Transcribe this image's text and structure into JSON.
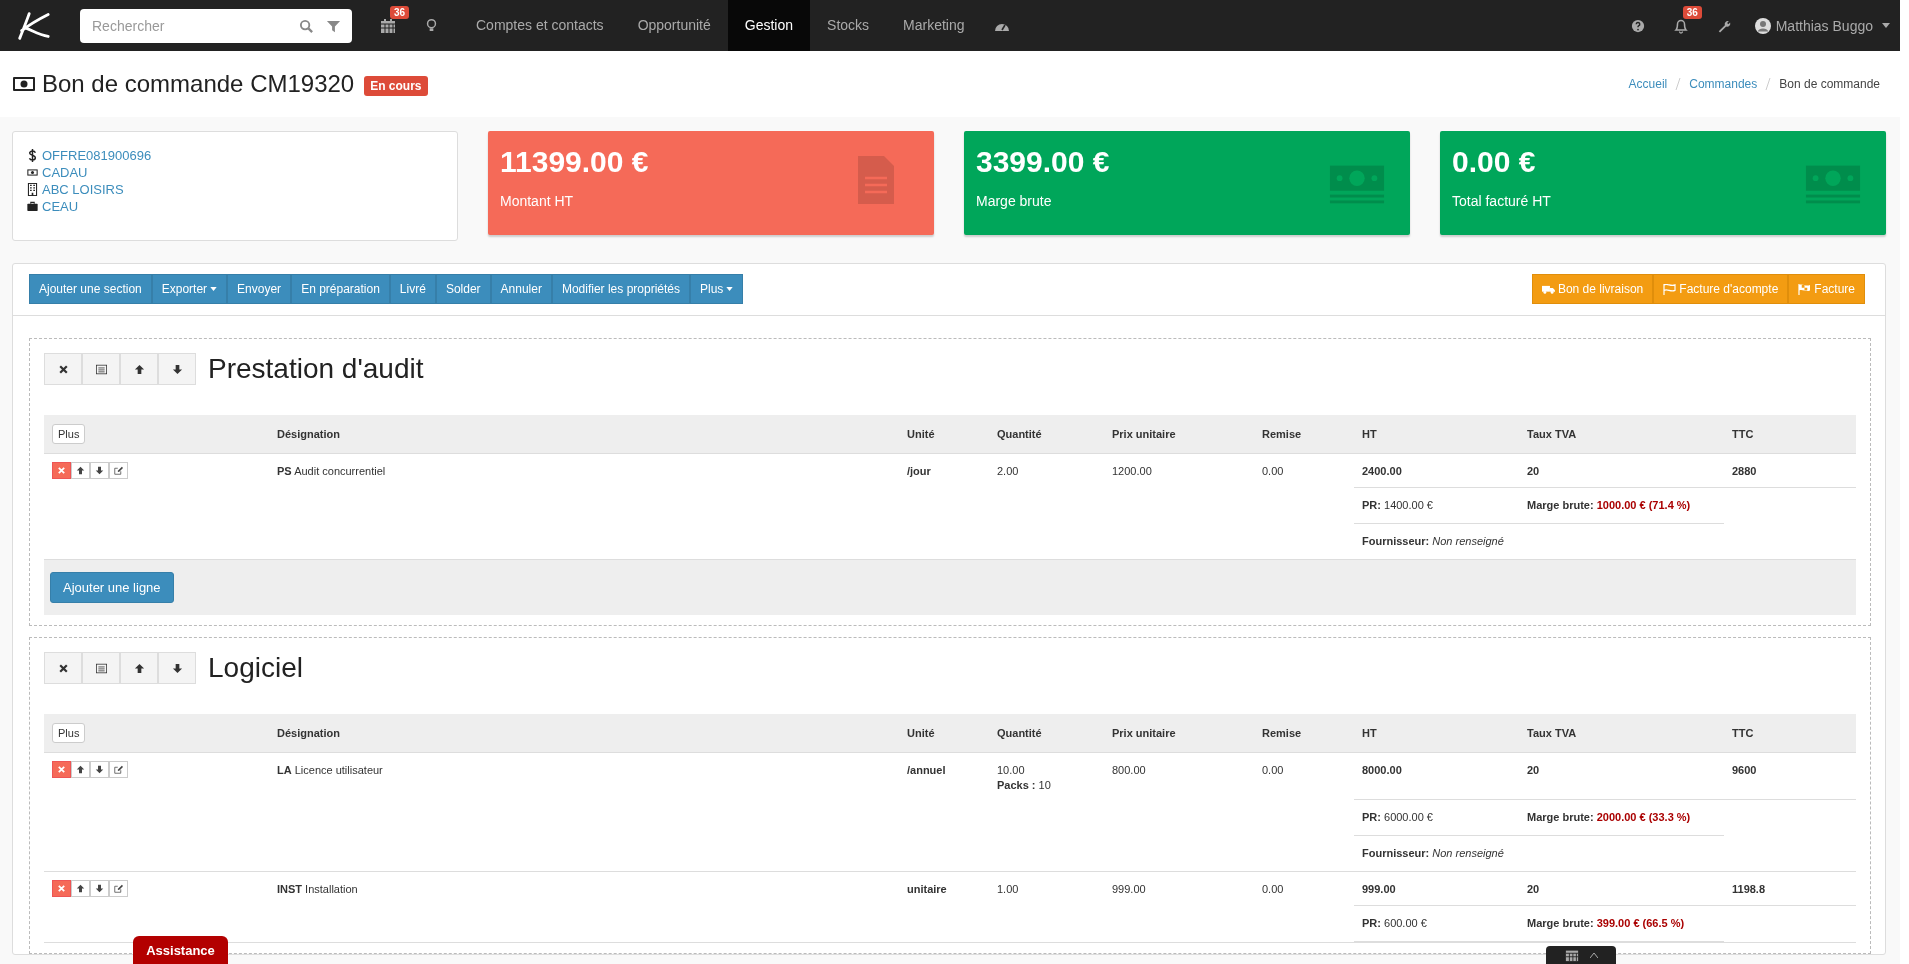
{
  "navbar": {
    "search": {
      "placeholder": "Rechercher"
    },
    "calendar_badge": "36",
    "menu": [
      {
        "label": "Comptes et contacts",
        "selected": false
      },
      {
        "label": "Opportunité",
        "selected": false
      },
      {
        "label": "Gestion",
        "selected": true
      },
      {
        "label": "Stocks",
        "selected": false
      },
      {
        "label": "Marketing",
        "selected": false
      }
    ],
    "notifications_badge": "36",
    "user": {
      "name": "Matthias Buggo"
    }
  },
  "page": {
    "title": "Bon de commande CM19320",
    "status": "En cours",
    "breadcrumb": [
      {
        "label": "Accueil",
        "link": true
      },
      {
        "label": "Commandes",
        "link": true
      },
      {
        "label": "Bon de commande",
        "link": false
      }
    ]
  },
  "links": [
    "OFFRE081900696",
    "CADAU",
    "ABC LOISIRS",
    "CEAU"
  ],
  "stats": [
    {
      "value": "11399.00 €",
      "label": "Montant HT",
      "color": "#f56a58"
    },
    {
      "value": "3399.00 €",
      "label": "Marge brute",
      "color": "#00a65a"
    },
    {
      "value": "0.00 €",
      "label": "Total facturé HT",
      "color": "#00a65a"
    }
  ],
  "toolbar": {
    "actions": [
      {
        "label": "Ajouter une section",
        "dropdown": false
      },
      {
        "label": "Exporter",
        "dropdown": true
      },
      {
        "label": "Envoyer",
        "dropdown": false
      },
      {
        "label": "En préparation",
        "dropdown": false
      },
      {
        "label": "Livré",
        "dropdown": false
      },
      {
        "label": "Solder",
        "dropdown": false
      },
      {
        "label": "Annuler",
        "dropdown": false
      },
      {
        "label": "Modifier les propriétés",
        "dropdown": false
      },
      {
        "label": "Plus",
        "dropdown": true
      }
    ],
    "documents": [
      "Bon de livraison",
      "Facture d'acompte",
      "Facture"
    ]
  },
  "sections": [
    {
      "title": "Prestation d'audit",
      "more_button": "Plus",
      "columns": [
        "Désignation",
        "Unité",
        "Quantité",
        "Prix unitaire",
        "Remise",
        "HT",
        "Taux TVA",
        "TTC"
      ],
      "rows": [
        {
          "designation": "**PS** Audit concurrentiel",
          "unit": "/jour",
          "quantity": "2.00",
          "unit_price": "1200.00",
          "discount": "0.00",
          "ht": "2400.00",
          "vat_rate": "20",
          "ttc": "2880",
          "pr": {
            "label": "PR:",
            "value": "1400.00 €"
          },
          "margin": {
            "label": "Marge brute:",
            "value": "1000.00 € (71.4 %)"
          },
          "supplier": {
            "label": "Fournisseur:",
            "value": "Non renseigné"
          }
        }
      ],
      "add_line_button": "Ajouter une ligne"
    },
    {
      "title": "Logiciel",
      "more_button": "Plus",
      "columns": [
        "Désignation",
        "Unité",
        "Quantité",
        "Prix unitaire",
        "Remise",
        "HT",
        "Taux TVA",
        "TTC"
      ],
      "rows": [
        {
          "designation": "**LA** Licence utilisateur",
          "unit": "/annuel",
          "quantity": "10.00",
          "packs": {
            "label": "Packs :",
            "value": "10"
          },
          "unit_price": "800.00",
          "discount": "0.00",
          "ht": "8000.00",
          "vat_rate": "20",
          "ttc": "9600",
          "pr": {
            "label": "PR:",
            "value": "6000.00 €"
          },
          "margin": {
            "label": "Marge brute:",
            "value": "2000.00 € (33.3 %)"
          },
          "supplier": {
            "label": "Fournisseur:",
            "value": "Non renseigné"
          }
        },
        {
          "designation": "**INST** Installation",
          "unit": "unitaire",
          "quantity": "1.00",
          "unit_price": "999.00",
          "discount": "0.00",
          "ht": "999.00",
          "vat_rate": "20",
          "ttc": "1198.8",
          "pr": {
            "label": "PR:",
            "value": "600.00 €"
          },
          "margin": {
            "label": "Marge brute:",
            "value": "399.00 € (66.5 %)"
          }
        }
      ]
    }
  ],
  "assistance": "Assistance"
}
